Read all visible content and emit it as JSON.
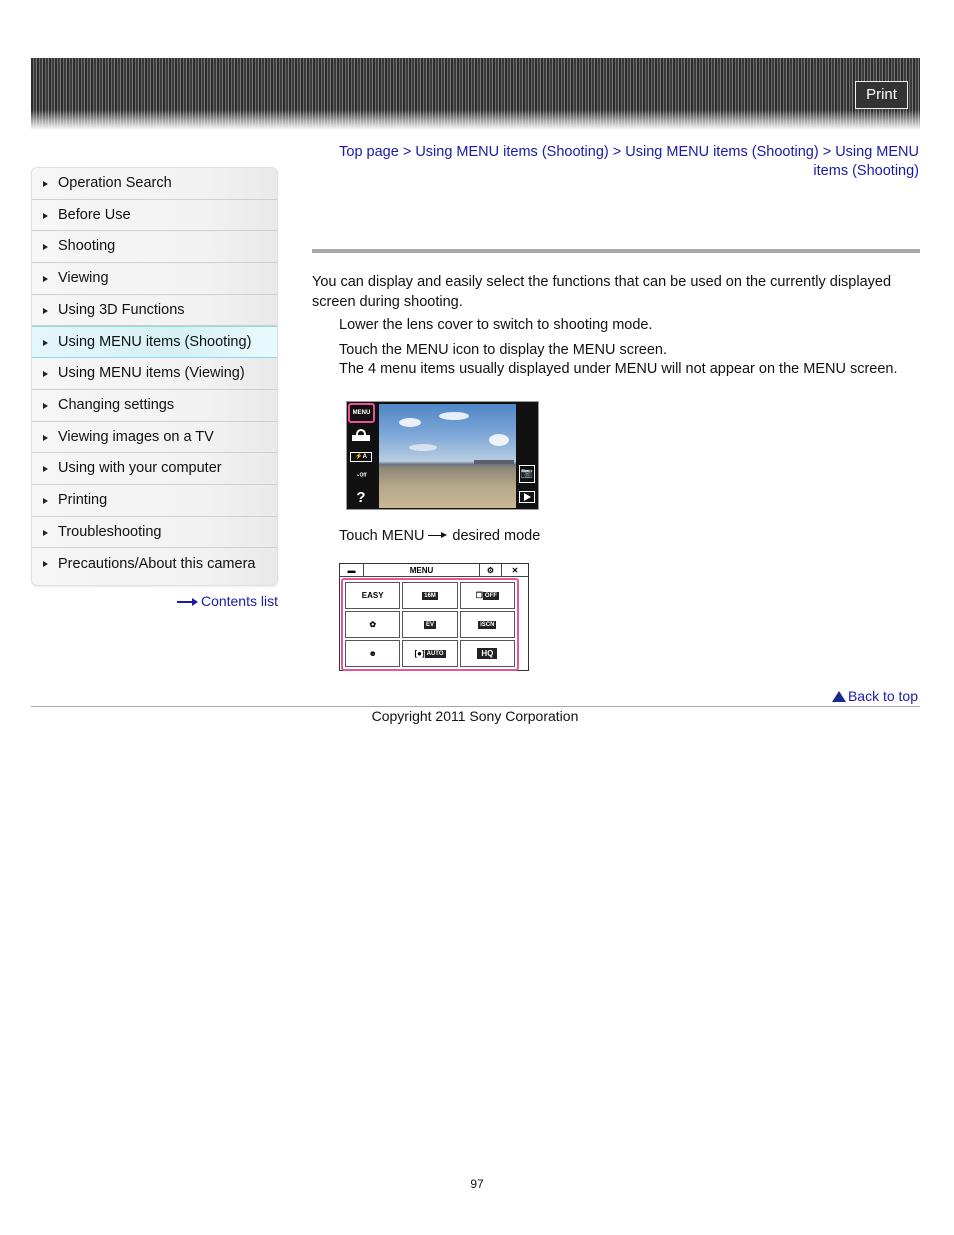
{
  "header": {
    "print_label": "Print"
  },
  "sidebar": {
    "items": [
      {
        "label": "Operation Search",
        "active": false
      },
      {
        "label": "Before Use",
        "active": false
      },
      {
        "label": "Shooting",
        "active": false
      },
      {
        "label": "Viewing",
        "active": false
      },
      {
        "label": "Using 3D Functions",
        "active": false
      },
      {
        "label": "Using MENU items (Shooting)",
        "active": true
      },
      {
        "label": "Using MENU items (Viewing)",
        "active": false
      },
      {
        "label": "Changing settings",
        "active": false
      },
      {
        "label": "Viewing images on a TV",
        "active": false
      },
      {
        "label": "Using with your computer",
        "active": false
      },
      {
        "label": "Printing",
        "active": false
      },
      {
        "label": "Troubleshooting",
        "active": false
      },
      {
        "label": "Precautions/About this camera",
        "active": false
      }
    ],
    "contents_list_label": "Contents list"
  },
  "breadcrumb": {
    "items": [
      "Top page",
      "Using MENU items (Shooting)",
      "Using MENU items (Shooting)",
      "Using MENU items (Shooting)"
    ],
    "separator": ">"
  },
  "content": {
    "intro": "You can display and easily select the functions that can be used on the currently displayed screen during shooting.",
    "step1": "Lower the lens cover to switch to shooting mode.",
    "step2": "Touch the MENU icon to display the MENU screen.",
    "step2_note": "The 4 menu items usually displayed under MENU will not appear on the MENU screen.",
    "step3_prefix": "Touch MENU",
    "step3_suffix": "desired mode",
    "camera_screen": {
      "left_icons": [
        "MENU",
        "ISO-icon",
        "flash-auto-icon",
        "self-timer-off-icon",
        "help-icon"
      ],
      "right_icons": [
        "shooting-mode-icon",
        "playback-icon"
      ],
      "menu_label": "MENU",
      "help_label": "?"
    },
    "menu_screen": {
      "title": "MENU",
      "tiles": [
        "EASY",
        "16M",
        "OFF",
        "macro",
        "EV",
        "iSCN",
        "smile",
        "AUTO",
        "HQ"
      ]
    }
  },
  "footer": {
    "back_to_top": "Back to top",
    "copyright": "Copyright 2011 Sony Corporation",
    "page_number": "97"
  },
  "colors": {
    "link": "#1a1aa6",
    "highlight": "#e8559a",
    "active_nav": "#d6f0f4"
  }
}
